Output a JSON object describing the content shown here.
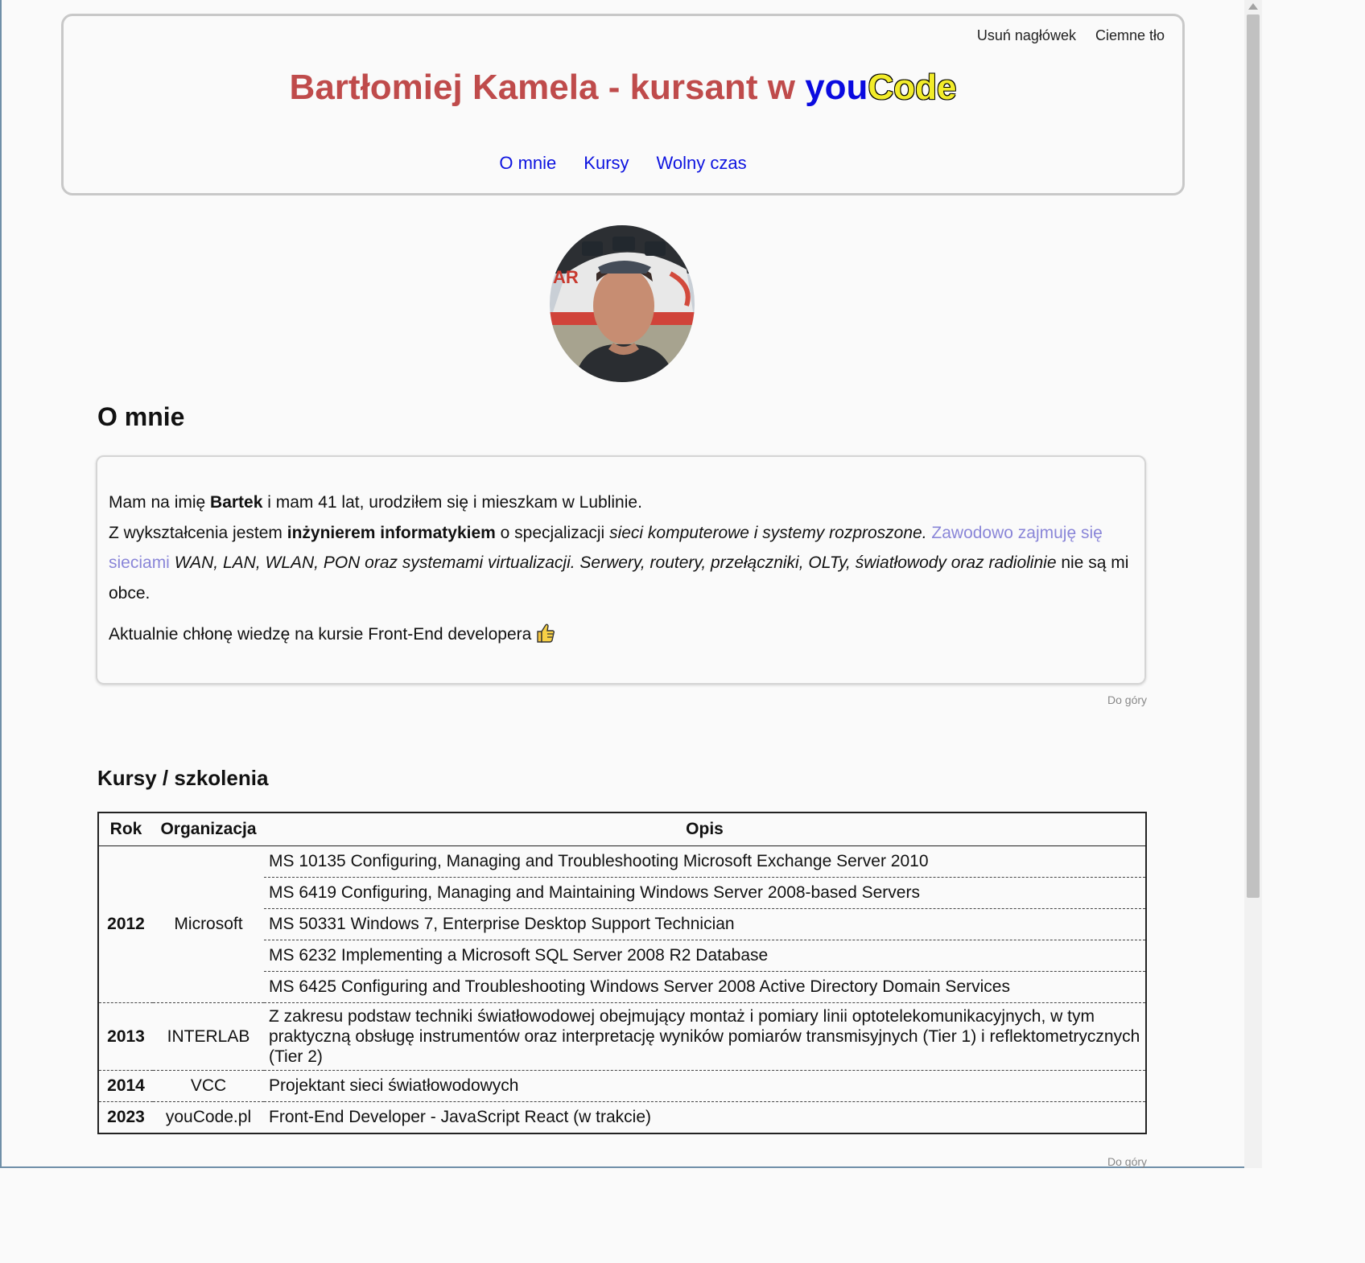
{
  "header": {
    "action_remove_header": "Usuń nagłówek",
    "action_dark_bg": "Ciemne tło",
    "title_main": "Bartłomiej Kamela - kursant w ",
    "title_you": "you",
    "title_code": "Code",
    "nav": [
      "O mnie",
      "Kursy",
      "Wolny czas"
    ]
  },
  "about": {
    "heading": "O mnie",
    "line1_a": "Mam na imię ",
    "line1_name": "Bartek",
    "line1_b": " i mam 41 lat, urodziłem się i mieszkam w Lublinie.",
    "line2_a": "Z wykształcenia jestem ",
    "line2_bold": "inżynierem informatykiem",
    "line2_b": " o specjalizacji ",
    "line2_italic": "sieci komputerowe i systemy rozproszone.",
    "line2_link": "Zawodowo zajmuję się sieciami",
    "line2_italic2": " WAN, LAN, WLAN, PON oraz systemami virtualizacji. Serwery, routery, przełączniki, OLTy, światłowody oraz radiolinie",
    "line2_end": " nie są mi obce.",
    "line3": "Aktualnie chłonę wiedzę na kursie Front-End developera ",
    "to_top": "Do góry"
  },
  "courses": {
    "heading": "Kursy / szkolenia",
    "columns": [
      "Rok",
      "Organizacja",
      "Opis"
    ],
    "groups": [
      {
        "year": "2012",
        "org": "Microsoft",
        "items": [
          "MS 10135 Configuring, Managing and Troubleshooting Microsoft Exchange Server 2010",
          "MS 6419 Configuring, Managing and Maintaining Windows Server 2008-based Servers",
          "MS 50331 Windows 7, Enterprise Desktop Support Technician",
          "MS 6232 Implementing a Microsoft SQL Server 2008 R2 Database",
          "MS 6425 Configuring and Troubleshooting Windows Server 2008 Active Directory Domain Services"
        ]
      },
      {
        "year": "2013",
        "org": "INTERLAB",
        "items": [
          "Z zakresu podstaw techniki światłowodowej obejmujący montaż i pomiary linii optotelekomunikacyjnych, w tym praktyczną obsługę instrumentów oraz interpretację wyników pomiarów transmisyjnych (Tier 1) i reflektometrycznych (Tier 2)"
        ]
      },
      {
        "year": "2014",
        "org": "VCC",
        "items": [
          "Projektant sieci światłowodowych"
        ]
      },
      {
        "year": "2023",
        "org": "youCode.pl",
        "items": [
          "Front-End Developer - JavaScript React (w trakcie)"
        ]
      }
    ],
    "to_top": "Do góry"
  }
}
